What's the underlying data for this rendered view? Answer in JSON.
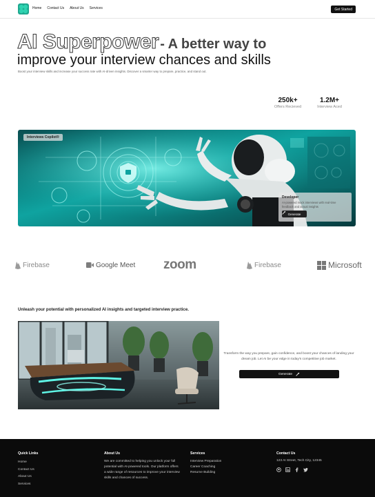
{
  "nav": {
    "links": [
      "Home",
      "Contact Us",
      "About Us",
      "Services"
    ],
    "cta": "Get Started"
  },
  "hero": {
    "title_outline": "AI Superpower",
    "title_rest": "- A better way to",
    "title_line2": "improve your interview chances and skills",
    "subtitle": "Boost your interview skills and increase your success rate with AI-driven insights. Discover a smarter way to prepare, practice, and stand out."
  },
  "stats": [
    {
      "value": "250k+",
      "label": "Offers Recieved"
    },
    {
      "value": "1.2M+",
      "label": "Interview Aced"
    }
  ],
  "banner": {
    "tag": "Interviews Copilot®",
    "card_title": "Developer",
    "card_text": "AI-powered mock interviews with real-time feedback and actual insights",
    "card_button": "Generate"
  },
  "logos": [
    "Firebase",
    "Google Meet",
    "zoom",
    "Firebase",
    "Microsoft"
  ],
  "section": {
    "heading": "Unleash your potential with personalized AI insights and targeted interview practice.",
    "text": "Transform the way you prepare, gain confidence, and boost your chances of landing your dream job. Let AI be your edge in today's competitive job market.",
    "button": "Generate"
  },
  "footer": {
    "quick_links": {
      "title": "Quick Links",
      "items": [
        "Home",
        "Contact Us",
        "About Us",
        "Services"
      ]
    },
    "about": {
      "title": "About Us",
      "text": "We are committed to helping you unlock your full potential with AI-powered tools. Our platform offers a wide range of resources to improve your interview skills and chances of success."
    },
    "services": {
      "title": "Services",
      "items": [
        "Interview Preparation",
        "Career Coaching",
        "Resume Building"
      ]
    },
    "contact": {
      "title": "Contact Us",
      "address": "123 AI Street, Tech City, 12345"
    },
    "social_icons": [
      "github-icon",
      "linkedin-icon",
      "facebook-icon",
      "twitter-icon"
    ]
  },
  "colors": {
    "brand": "#1fa88f",
    "dark": "#111111",
    "teal": "#0f9e9a"
  }
}
